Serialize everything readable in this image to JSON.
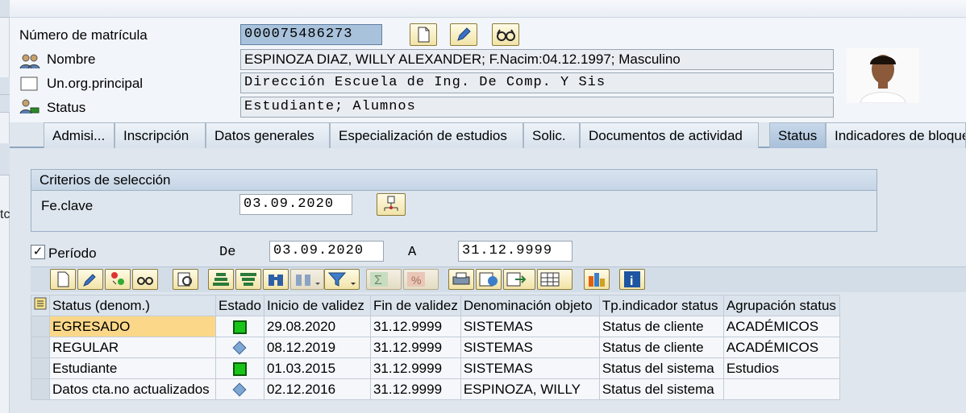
{
  "header": {
    "matricula_label": "Número de matrícula",
    "matricula_value": "000075486273",
    "nombre_label": "Nombre",
    "nombre_value": "ESPINOZA DIAZ, WILLY ALEXANDER; F.Nacim:04.12.1997; Masculino",
    "unorg_label": "Un.org.principal",
    "unorg_value": "Dirección Escuela de Ing. De Comp. Y Sis",
    "status_label": "Status",
    "status_value": "Estudiante; Alumnos"
  },
  "left_strip": {
    "fragment": "tc"
  },
  "tabs": [
    {
      "label": "Admisi..."
    },
    {
      "label": "Inscripción"
    },
    {
      "label": "Datos generales"
    },
    {
      "label": "Especialización de estudios"
    },
    {
      "label": "Solic."
    },
    {
      "label": "Documentos de actividad"
    },
    {
      "label": "Status"
    },
    {
      "label": "Indicadores de bloqueo"
    }
  ],
  "criteria": {
    "title": "Criterios de selección",
    "feclave_label": "Fe.clave",
    "feclave_value": "03.09.2020"
  },
  "periodo": {
    "checked": "✓",
    "label": "Período",
    "de_label": "De",
    "de_value": "03.09.2020",
    "a_label": "A",
    "a_value": "31.12.9999"
  },
  "table": {
    "columns": [
      "Status (denom.)",
      "Estado",
      "Inicio de validez",
      "Fin de validez",
      "Denominación objeto",
      "Tp.indicador status",
      "Agrupación status"
    ],
    "rows": [
      {
        "status": "EGRESADO",
        "estado": "green-square",
        "inicio": "29.08.2020",
        "fin": "31.12.9999",
        "objeto": "SISTEMAS",
        "tipo": "Status de cliente",
        "grupo": "ACADÉMICOS"
      },
      {
        "status": "REGULAR",
        "estado": "blue-diamond",
        "inicio": "08.12.2019",
        "fin": "31.12.9999",
        "objeto": "SISTEMAS",
        "tipo": "Status de cliente",
        "grupo": "ACADÉMICOS"
      },
      {
        "status": "Estudiante",
        "estado": "green-square",
        "inicio": "01.03.2015",
        "fin": "31.12.9999",
        "objeto": "SISTEMAS",
        "tipo": "Status del sistema",
        "grupo": "Estudios"
      },
      {
        "status": "Datos cta.no actualizados",
        "estado": "blue-diamond",
        "inicio": "02.12.2016",
        "fin": "31.12.9999",
        "objeto": "ESPINOZA, WILLY",
        "tipo": "Status del sistema",
        "grupo": ""
      }
    ]
  },
  "colors": {
    "accent": "#a9c0d9",
    "highlight": "#fbd889",
    "status_green": "#19c419",
    "diamond_blue": "#7fa7d3"
  }
}
